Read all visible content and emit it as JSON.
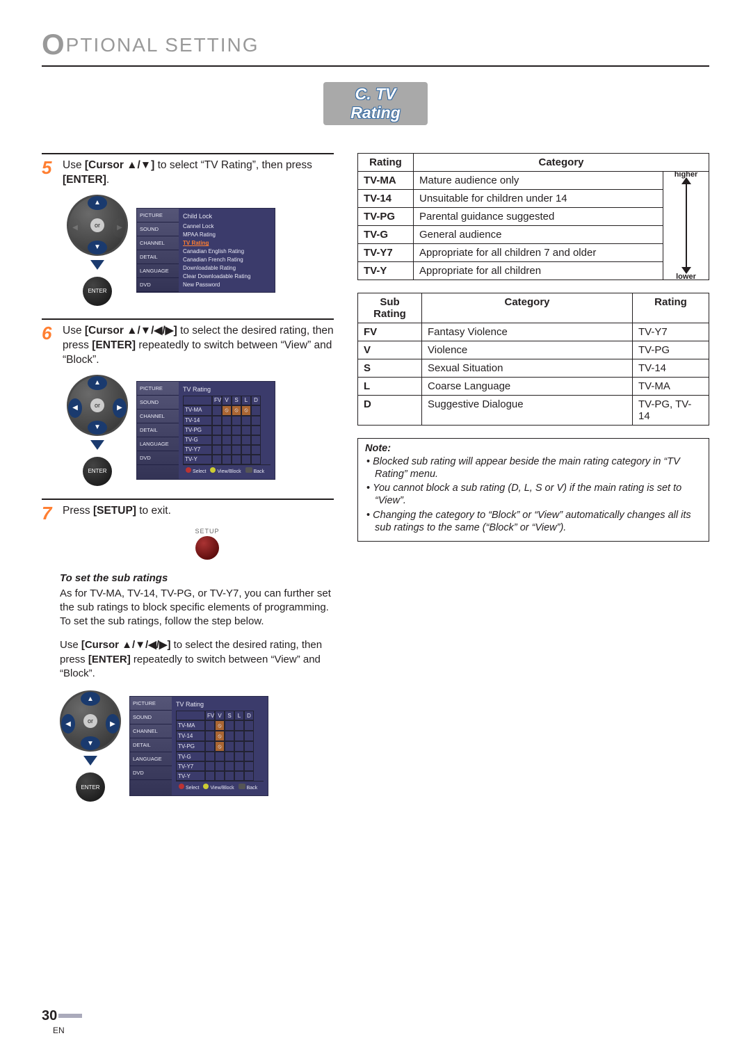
{
  "header": {
    "title": "PTIONAL  SETTING",
    "big_o": "O"
  },
  "section_badge": "C. TV Rating",
  "steps": {
    "s5": {
      "num": "5",
      "text_pre": "Use ",
      "text_bold1": "[Cursor ▲/▼]",
      "text_mid": " to select “TV Rating”, then press ",
      "text_bold2": "[ENTER]",
      "text_post": "."
    },
    "s6": {
      "num": "6",
      "text_pre": "Use ",
      "text_bold1": "[Cursor ▲/▼/◀/▶]",
      "text_mid": " to select the desired rating, then press ",
      "text_bold2": "[ENTER]",
      "text_post": " repeatedly to switch between “View” and “Block”."
    },
    "s7": {
      "num": "7",
      "text_pre": "Press ",
      "text_bold1": "[SETUP]",
      "text_post": " to exit."
    }
  },
  "remote": {
    "or": "or",
    "enter": "ENTER",
    "setup": "SETUP",
    "up": "▲",
    "down": "▼",
    "left": "◀",
    "right": "▶"
  },
  "osd_side": [
    "PICTURE",
    "SOUND",
    "CHANNEL",
    "DETAIL",
    "LANGUAGE",
    "DVD"
  ],
  "osd1": {
    "title": "Child Lock",
    "items": [
      "Cannel Lock",
      "MPAA Rating",
      "TV Rating",
      "Canadian English Rating",
      "Canadian French Rating",
      "Downloadable Rating",
      "Clear Downloadable Rating",
      "New Password"
    ],
    "selected": "TV Rating"
  },
  "osd2": {
    "title": "TV Rating",
    "cols": [
      "",
      "FV",
      "V",
      "S",
      "L",
      "D"
    ],
    "rows": [
      "TV-MA",
      "TV-14",
      "TV-PG",
      "TV-G",
      "TV-Y7",
      "TV-Y"
    ],
    "foot_select": "Select",
    "foot_view": "View/Block",
    "foot_back": "Back"
  },
  "subrat": {
    "heading": "To set the sub ratings",
    "p1": "As for TV-MA, TV-14, TV-PG, or TV-Y7, you can further set the sub ratings to block specific elements of programming. To set the sub ratings, follow the step below.",
    "p2_pre": "Use ",
    "p2_b1": "[Cursor ▲/▼/◀/▶]",
    "p2_mid": " to select the desired rating, then press ",
    "p2_b2": "[ENTER]",
    "p2_post": " repeatedly to switch between “View” and “Block”."
  },
  "tbl1": {
    "h_rating": "Rating",
    "h_category": "Category",
    "arrow_top": "higher",
    "arrow_bot": "lower",
    "rows": [
      {
        "r": "TV-MA",
        "c": "Mature audience only"
      },
      {
        "r": "TV-14",
        "c": "Unsuitable for children under 14"
      },
      {
        "r": "TV-PG",
        "c": "Parental guidance suggested"
      },
      {
        "r": "TV-G",
        "c": "General audience"
      },
      {
        "r": "TV-Y7",
        "c": "Appropriate for all children 7 and older"
      },
      {
        "r": "TV-Y",
        "c": "Appropriate for all children"
      }
    ]
  },
  "tbl2": {
    "h_sub": "Sub Rating",
    "h_cat": "Category",
    "h_rat": "Rating",
    "rows": [
      {
        "s": "FV",
        "c": "Fantasy Violence",
        "r": "TV-Y7"
      },
      {
        "s": "V",
        "c": "Violence",
        "r": "TV-PG"
      },
      {
        "s": "S",
        "c": "Sexual Situation",
        "r": "TV-14"
      },
      {
        "s": "L",
        "c": "Coarse Language",
        "r": "TV-MA"
      },
      {
        "s": "D",
        "c": "Suggestive Dialogue",
        "r": "TV-PG, TV-14"
      }
    ]
  },
  "note": {
    "heading": "Note:",
    "items": [
      "Blocked sub rating will appear beside the main rating category in “TV Rating” menu.",
      "You cannot block a sub rating (D, L, S or V) if the main rating is set to “View”.",
      "Changing the category to “Block” or “View” automatically changes all its sub ratings to the same (“Block” or “View”)."
    ]
  },
  "footer": {
    "page": "30",
    "lang": "EN"
  }
}
